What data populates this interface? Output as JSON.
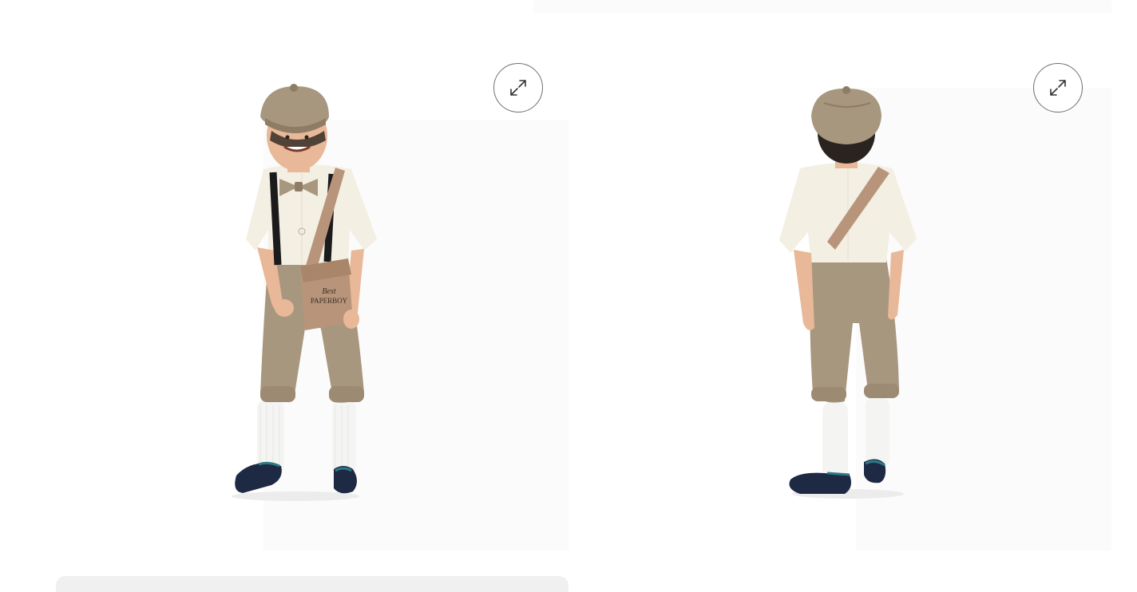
{
  "gallery": {
    "images": [
      {
        "view": "front",
        "bag_text_line1": "Best",
        "bag_text_line2": "PAPERBOY",
        "expand_icon": "expand-arrows-icon"
      },
      {
        "view": "back",
        "expand_icon": "expand-arrows-icon"
      }
    ]
  },
  "colors": {
    "background": "#ffffff",
    "tweed": "#a8977f",
    "tweed_dark": "#8e7c64",
    "shirt": "#f3efe3",
    "skin": "#e8b898",
    "hair": "#2a2420",
    "suspenders": "#1b1b1b",
    "satchel": "#b8957a",
    "socks": "#f4f4f2",
    "shoes": "#1e2a44",
    "shoe_trim": "#2d7a86",
    "icon_stroke": "#333333"
  }
}
